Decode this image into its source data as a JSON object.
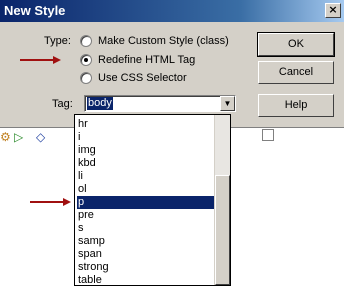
{
  "dialog": {
    "title": "New Style",
    "close_glyph": "×",
    "type_label": "Type:",
    "type_options": [
      {
        "label": "Make Custom Style (class)",
        "checked": false
      },
      {
        "label": "Redefine HTML Tag",
        "checked": true
      },
      {
        "label": "Use CSS Selector",
        "checked": false
      }
    ],
    "tag_label": "Tag:",
    "tag_value": "body",
    "dropdown_arrow": "▼",
    "buttons": {
      "ok": "OK",
      "cancel": "Cancel",
      "help": "Help"
    }
  },
  "toolbar": {
    "icons": [
      "gear-icon",
      "play-icon",
      "code-view-icon",
      "document-icon"
    ],
    "gear_glyph": "⚙",
    "play_glyph": "▷",
    "code_glyph": "◇"
  },
  "tag_list": {
    "items": [
      "hr",
      "i",
      "img",
      "kbd",
      "li",
      "ol",
      "p",
      "pre",
      "s",
      "samp",
      "span",
      "strong",
      "table"
    ],
    "selected": "p"
  },
  "colors": {
    "selection": "#0a246a",
    "annotation_arrow": "#a01010",
    "dialog_face": "#d4d0c8"
  }
}
